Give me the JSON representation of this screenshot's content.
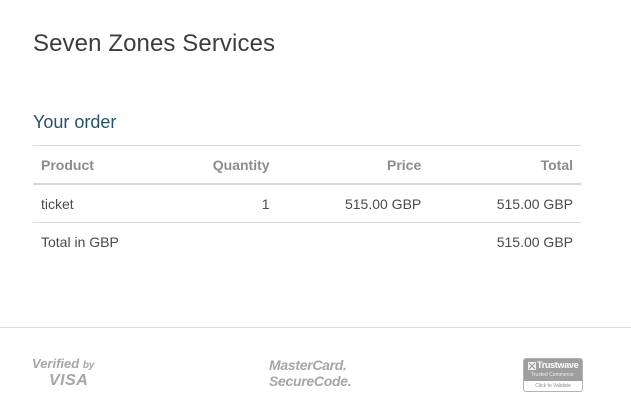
{
  "merchant": {
    "name": "Seven Zones Services"
  },
  "order": {
    "heading": "Your order",
    "columns": {
      "product": "Product",
      "quantity": "Quantity",
      "price": "Price",
      "total": "Total"
    },
    "items": [
      {
        "product": "ticket",
        "quantity": "1",
        "price": "515.00 GBP",
        "total": "515.00 GBP"
      }
    ],
    "summary": {
      "label": "Total in GBP",
      "total": "515.00 GBP"
    }
  },
  "footer": {
    "visa": {
      "line1": "Verified",
      "by": "by",
      "line2": "VISA"
    },
    "mastercard": {
      "line1": "MasterCard.",
      "line2": "SecureCode."
    },
    "trustwave": {
      "name": "Trustwave",
      "subtitle": "Trusted Commerce",
      "action": "Click to Validate",
      "icon": "trustwave-shield-icon"
    }
  },
  "colors": {
    "heading_accent": "#27526a",
    "title_text": "#3d3d3d",
    "header_text": "#8c8c8c",
    "divider": "#d8d8d8",
    "logo_gray": "#a6a6a6"
  }
}
